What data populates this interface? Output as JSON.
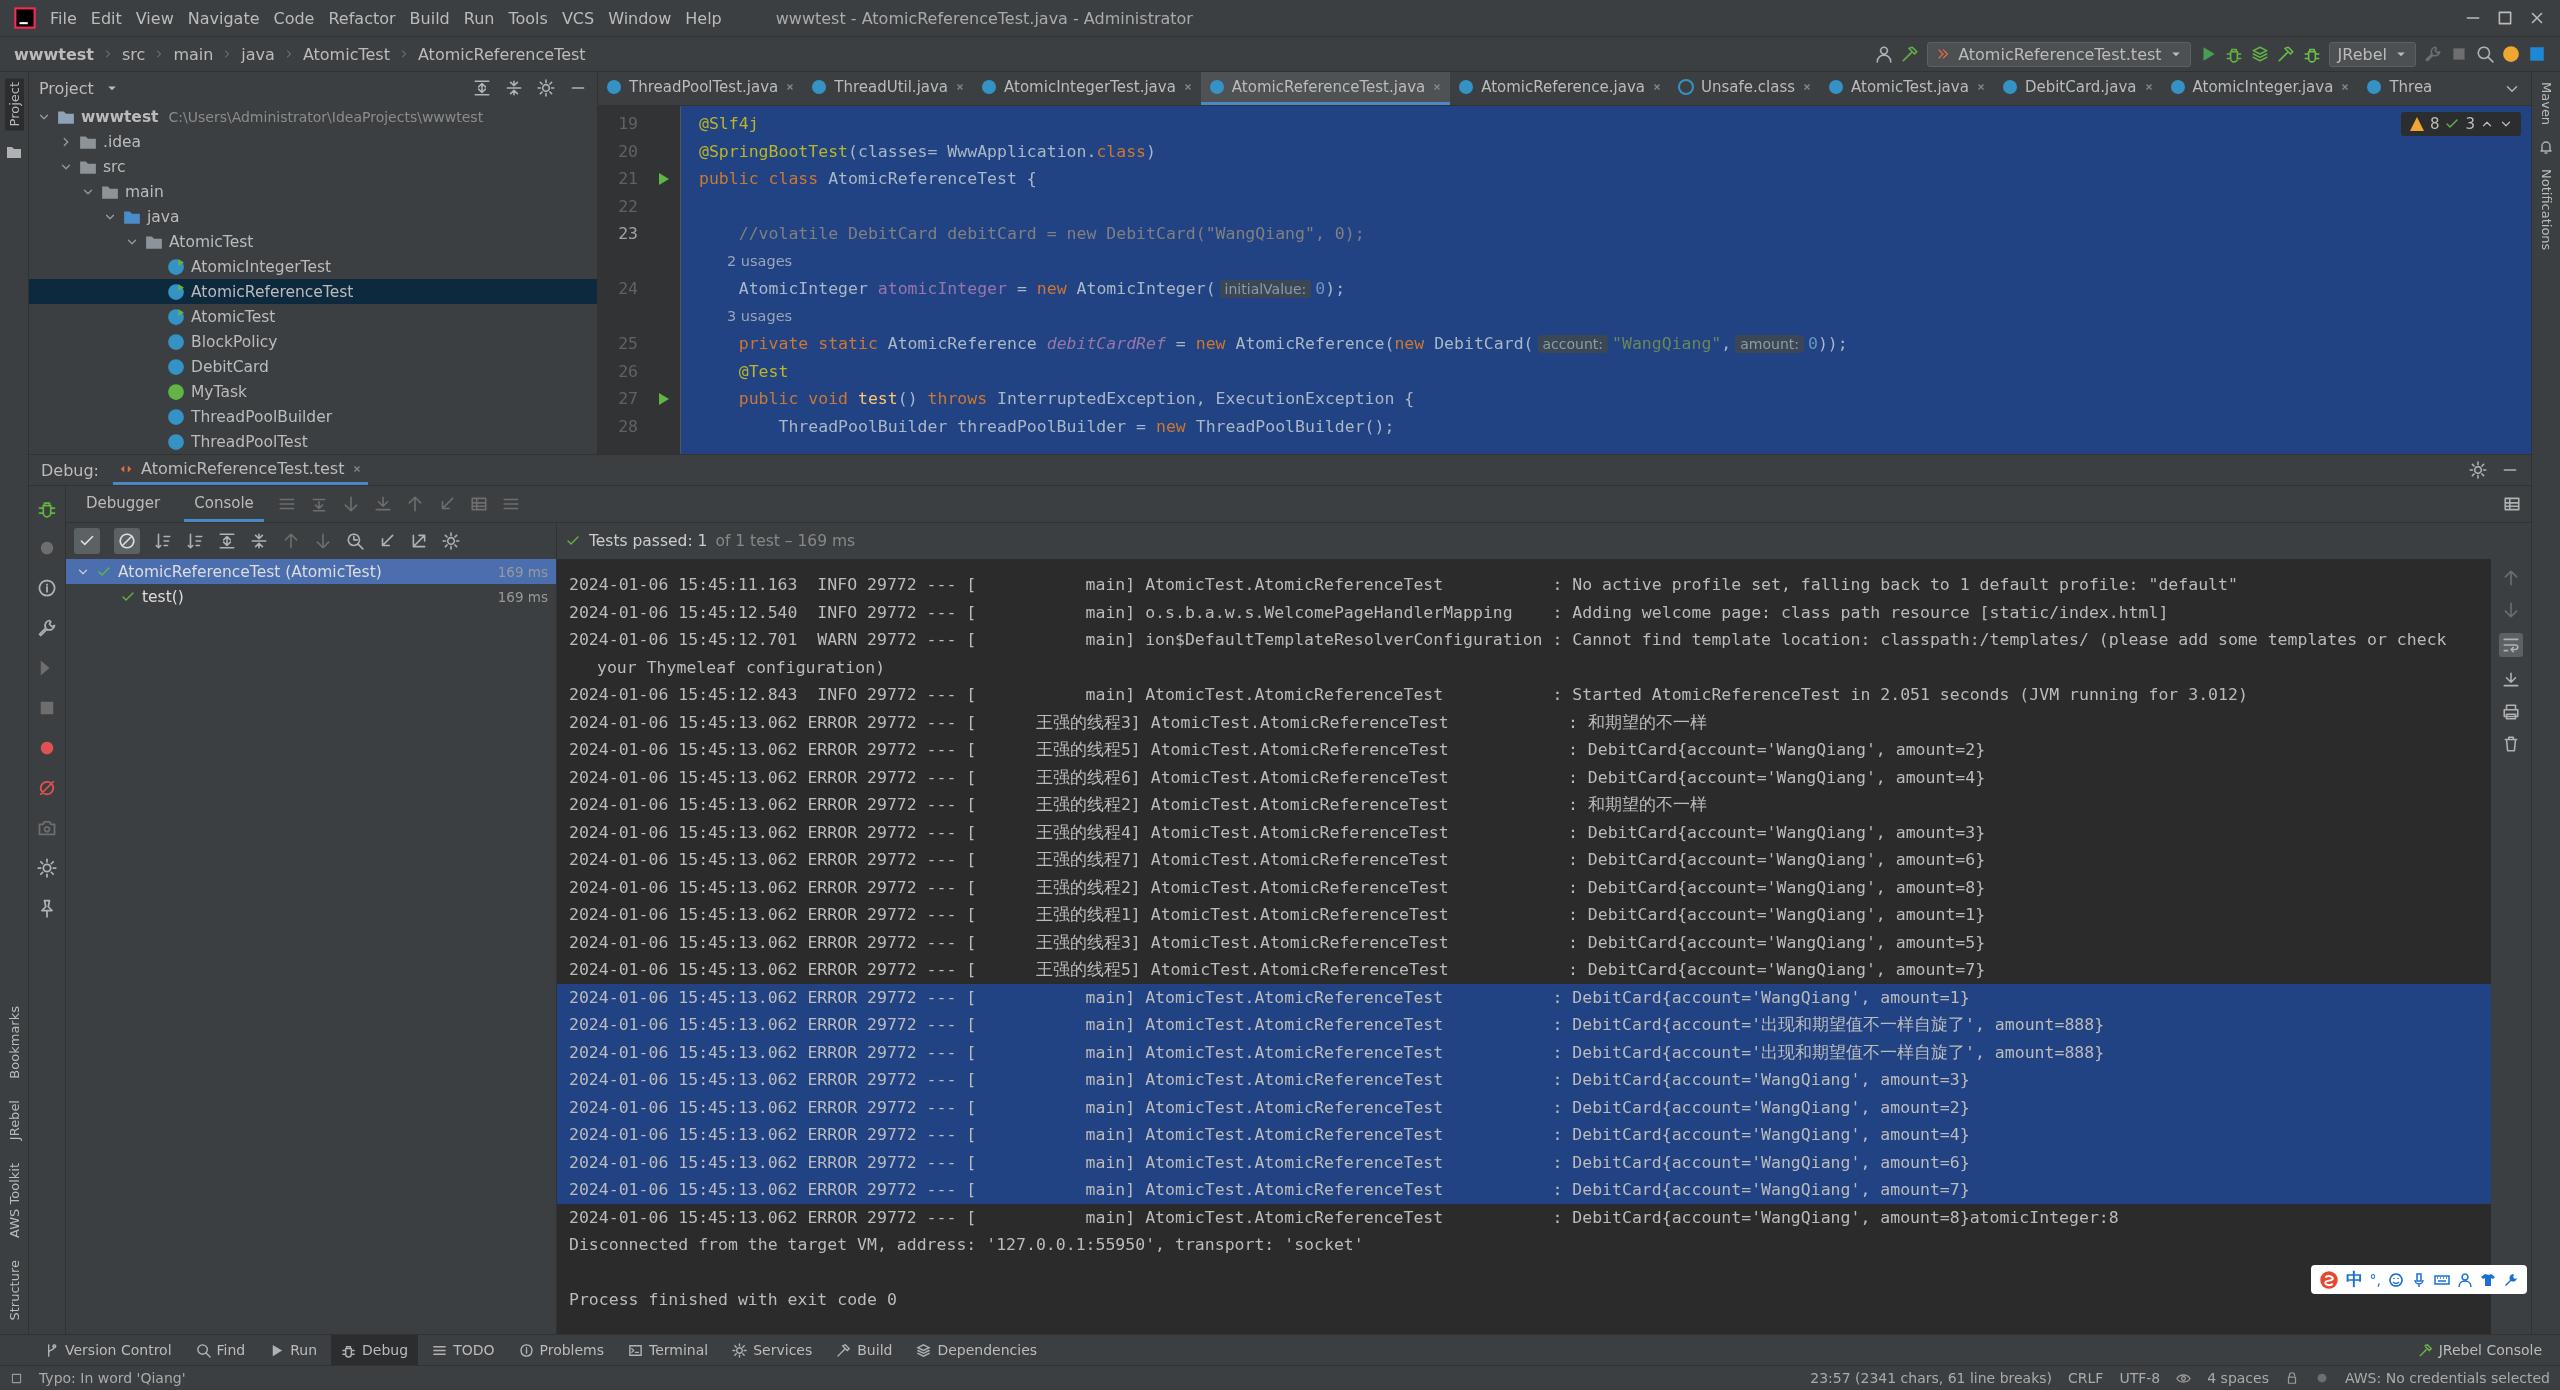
{
  "window": {
    "title": "wwwtest - AtomicReferenceTest.java - Administrator"
  },
  "menu": [
    "File",
    "Edit",
    "View",
    "Navigate",
    "Code",
    "Refactor",
    "Build",
    "Run",
    "Tools",
    "VCS",
    "Window",
    "Help"
  ],
  "breadcrumbs": [
    "wwwtest",
    "src",
    "main",
    "java",
    "AtomicTest",
    "AtomicReferenceTest"
  ],
  "run_config": {
    "label": "AtomicReferenceTest.test"
  },
  "jrebel": {
    "label": "JRebel"
  },
  "project_panel": {
    "title": "Project",
    "tree": [
      {
        "label": "wwwtest",
        "path": "C:\\Users\\Administrator\\IdeaProjects\\wwwtest",
        "kind": "module",
        "expanded": true,
        "selected": false,
        "children": [
          {
            "label": ".idea",
            "kind": "folder",
            "expanded": false,
            "selected": false
          },
          {
            "label": "src",
            "kind": "folder",
            "expanded": true,
            "selected": false,
            "children": [
              {
                "label": "main",
                "kind": "folder",
                "expanded": true,
                "selected": false,
                "children": [
                  {
                    "label": "java",
                    "kind": "source",
                    "expanded": true,
                    "selected": false,
                    "children": [
                      {
                        "label": "AtomicTest",
                        "kind": "package",
                        "expanded": true,
                        "selected": false,
                        "children": [
                          {
                            "label": "AtomicIntegerTest",
                            "kind": "test-class",
                            "selected": false
                          },
                          {
                            "label": "AtomicReferenceTest",
                            "kind": "test-class",
                            "selected": true
                          },
                          {
                            "label": "AtomicTest",
                            "kind": "test-class",
                            "selected": false
                          },
                          {
                            "label": "BlockPolicy",
                            "kind": "class",
                            "selected": false
                          },
                          {
                            "label": "DebitCard",
                            "kind": "class",
                            "selected": false
                          },
                          {
                            "label": "MyTask",
                            "kind": "interface",
                            "selected": false
                          },
                          {
                            "label": "ThreadPoolBuilder",
                            "kind": "class",
                            "selected": false
                          },
                          {
                            "label": "ThreadPoolTest",
                            "kind": "class",
                            "selected": false
                          }
                        ]
                      }
                    ]
                  }
                ]
              }
            ]
          }
        ]
      }
    ]
  },
  "editor_tabs": [
    {
      "label": "ThreadPoolTest.java",
      "kind": "class",
      "selected": false
    },
    {
      "label": "ThreadUtil.java",
      "kind": "class",
      "selected": false
    },
    {
      "label": "AtomicIntegerTest.java",
      "kind": "class",
      "selected": false
    },
    {
      "label": "AtomicReferenceTest.java",
      "kind": "class",
      "selected": true
    },
    {
      "label": "AtomicReference.java",
      "kind": "class",
      "selected": false
    },
    {
      "label": "Unsafe.class",
      "kind": "compiled",
      "selected": false
    },
    {
      "label": "AtomicTest.java",
      "kind": "class",
      "selected": false
    },
    {
      "label": "DebitCard.java",
      "kind": "class",
      "selected": false
    },
    {
      "label": "AtomicInteger.java",
      "kind": "class",
      "selected": false
    },
    {
      "label": "Threa",
      "kind": "class",
      "selected": false
    }
  ],
  "inspections": {
    "warnings": "8",
    "typos": "3"
  },
  "code_lines": [
    {
      "kind": "code",
      "number": "19",
      "tokens": [
        {
          "kind": "ann",
          "text": "@Slf4j"
        }
      ]
    },
    {
      "kind": "code",
      "number": "20",
      "tokens": [
        {
          "kind": "ann",
          "text": "@SpringBootTest"
        },
        {
          "kind": "plain",
          "text": "(classes= WwwApplication."
        },
        {
          "kind": "kw",
          "text": "class"
        },
        {
          "kind": "plain",
          "text": ")"
        }
      ]
    },
    {
      "kind": "code",
      "number": "21",
      "run": true,
      "tokens": [
        {
          "kind": "kw",
          "text": "public class "
        },
        {
          "kind": "plain",
          "text": "AtomicReferenceTest {"
        }
      ]
    },
    {
      "kind": "code",
      "number": "22"
    },
    {
      "kind": "code",
      "number": "23",
      "current": true,
      "tokens": [
        {
          "kind": "comment",
          "text": "    //volatile DebitCard debitCard = new DebitCard(\"WangQiang\", 0);"
        }
      ]
    },
    {
      "kind": "usages",
      "text": "2 usages"
    },
    {
      "kind": "code",
      "number": "24",
      "tokens": [
        {
          "kind": "plain",
          "text": "    AtomicInteger "
        },
        {
          "kind": "field",
          "text": "atomicInteger"
        },
        {
          "kind": "plain",
          "text": " = "
        },
        {
          "kind": "kw",
          "text": "new "
        },
        {
          "kind": "plain",
          "text": "AtomicInteger("
        },
        {
          "kind": "hint",
          "text": "initialValue:"
        },
        {
          "kind": "num",
          "text": "0"
        },
        {
          "kind": "plain",
          "text": ");"
        }
      ]
    },
    {
      "kind": "usages",
      "text": "3 usages"
    },
    {
      "kind": "code",
      "number": "25",
      "tokens": [
        {
          "kind": "kw",
          "text": "    private static "
        },
        {
          "kind": "plain",
          "text": "AtomicReference "
        },
        {
          "kind": "static",
          "text": "debitCardRef"
        },
        {
          "kind": "plain",
          "text": " = "
        },
        {
          "kind": "kw",
          "text": "new "
        },
        {
          "kind": "plain",
          "text": "AtomicReference("
        },
        {
          "kind": "kw",
          "text": "new "
        },
        {
          "kind": "plain",
          "text": "DebitCard("
        },
        {
          "kind": "hint",
          "text": "account:"
        },
        {
          "kind": "str",
          "text": "\"WangQiang\""
        },
        {
          "kind": "plain",
          "text": ","
        },
        {
          "kind": "hint",
          "text": "amount:"
        },
        {
          "kind": "num",
          "text": "0"
        },
        {
          "kind": "plain",
          "text": "));"
        }
      ]
    },
    {
      "kind": "code",
      "number": "26",
      "tokens": [
        {
          "kind": "ann",
          "text": "    @Test"
        }
      ]
    },
    {
      "kind": "code",
      "number": "27",
      "run": true,
      "tokens": [
        {
          "kind": "kw",
          "text": "    public void "
        },
        {
          "kind": "fn",
          "text": "test"
        },
        {
          "kind": "plain",
          "text": "() "
        },
        {
          "kind": "kw",
          "text": "throws "
        },
        {
          "kind": "plain",
          "text": "InterruptedException, ExecutionException {"
        }
      ]
    },
    {
      "kind": "code",
      "number": "28",
      "tokens": [
        {
          "kind": "plain",
          "text": "        ThreadPoolBuilder threadPoolBuilder = "
        },
        {
          "kind": "kw",
          "text": "new "
        },
        {
          "kind": "plain",
          "text": "ThreadPoolBuilder();"
        }
      ]
    }
  ],
  "debug": {
    "label": "Debug:",
    "session_tab": "AtomicReferenceTest.test",
    "tabs": [
      {
        "label": "Debugger",
        "selected": false
      },
      {
        "label": "Console",
        "selected": true
      }
    ],
    "tests_passed": "Tests passed: 1",
    "tests_summary": "of 1 test – 169 ms",
    "test_tree": [
      {
        "label": "AtomicReferenceTest (AtomicTest)",
        "time": "169 ms",
        "expanded": true,
        "selected": true,
        "children": [
          {
            "label": "test()",
            "time": "169 ms",
            "selected": false
          }
        ]
      }
    ]
  },
  "console_lines": [
    {
      "kind": "log",
      "selected": false,
      "text": "2024-01-06 15:45:11.163  INFO 29772 --- [           main] AtomicTest.AtomicReferenceTest           : No active profile set, falling back to 1 default profile: \"default\""
    },
    {
      "kind": "log",
      "selected": false,
      "text": "2024-01-06 15:45:12.540  INFO 29772 --- [           main] o.s.b.a.w.s.WelcomePageHandlerMapping    : Adding welcome page: class path resource [static/index.html]"
    },
    {
      "kind": "log",
      "selected": false,
      "text": "2024-01-06 15:45:12.701  WARN 29772 --- [           main] ion$DefaultTemplateResolverConfiguration : Cannot find template location: classpath:/templates/ (please add some templates or check"
    },
    {
      "kind": "wrap",
      "selected": false,
      "text": "your Thymeleaf configuration)"
    },
    {
      "kind": "log",
      "selected": false,
      "text": "2024-01-06 15:45:12.843  INFO 29772 --- [           main] AtomicTest.AtomicReferenceTest           : Started AtomicReferenceTest in 2.051 seconds (JVM running for 3.012)"
    },
    {
      "kind": "log",
      "selected": false,
      "text": "2024-01-06 15:45:13.062 ERROR 29772 --- [      王强的线程3] AtomicTest.AtomicReferenceTest            : 和期望的不一样"
    },
    {
      "kind": "log",
      "selected": false,
      "text": "2024-01-06 15:45:13.062 ERROR 29772 --- [      王强的线程5] AtomicTest.AtomicReferenceTest            : DebitCard{account='WangQiang', amount=2}"
    },
    {
      "kind": "log",
      "selected": false,
      "text": "2024-01-06 15:45:13.062 ERROR 29772 --- [      王强的线程6] AtomicTest.AtomicReferenceTest            : DebitCard{account='WangQiang', amount=4}"
    },
    {
      "kind": "log",
      "selected": false,
      "text": "2024-01-06 15:45:13.062 ERROR 29772 --- [      王强的线程2] AtomicTest.AtomicReferenceTest            : 和期望的不一样"
    },
    {
      "kind": "log",
      "selected": false,
      "text": "2024-01-06 15:45:13.062 ERROR 29772 --- [      王强的线程4] AtomicTest.AtomicReferenceTest            : DebitCard{account='WangQiang', amount=3}"
    },
    {
      "kind": "log",
      "selected": false,
      "text": "2024-01-06 15:45:13.062 ERROR 29772 --- [      王强的线程7] AtomicTest.AtomicReferenceTest            : DebitCard{account='WangQiang', amount=6}"
    },
    {
      "kind": "log",
      "selected": false,
      "text": "2024-01-06 15:45:13.062 ERROR 29772 --- [      王强的线程2] AtomicTest.AtomicReferenceTest            : DebitCard{account='WangQiang', amount=8}"
    },
    {
      "kind": "log",
      "selected": false,
      "text": "2024-01-06 15:45:13.062 ERROR 29772 --- [      王强的线程1] AtomicTest.AtomicReferenceTest            : DebitCard{account='WangQiang', amount=1}"
    },
    {
      "kind": "log",
      "selected": false,
      "text": "2024-01-06 15:45:13.062 ERROR 29772 --- [      王强的线程3] AtomicTest.AtomicReferenceTest            : DebitCard{account='WangQiang', amount=5}"
    },
    {
      "kind": "log",
      "selected": false,
      "text": "2024-01-06 15:45:13.062 ERROR 29772 --- [      王强的线程5] AtomicTest.AtomicReferenceTest            : DebitCard{account='WangQiang', amount=7}"
    },
    {
      "kind": "log",
      "selected": true,
      "text": "2024-01-06 15:45:13.062 ERROR 29772 --- [           main] AtomicTest.AtomicReferenceTest           : DebitCard{account='WangQiang', amount=1}"
    },
    {
      "kind": "log",
      "selected": true,
      "text": "2024-01-06 15:45:13.062 ERROR 29772 --- [           main] AtomicTest.AtomicReferenceTest           : DebitCard{account='出现和期望值不一样自旋了', amount=888}"
    },
    {
      "kind": "log",
      "selected": true,
      "text": "2024-01-06 15:45:13.062 ERROR 29772 --- [           main] AtomicTest.AtomicReferenceTest           : DebitCard{account='出现和期望值不一样自旋了', amount=888}"
    },
    {
      "kind": "log",
      "selected": true,
      "text": "2024-01-06 15:45:13.062 ERROR 29772 --- [           main] AtomicTest.AtomicReferenceTest           : DebitCard{account='WangQiang', amount=3}"
    },
    {
      "kind": "log",
      "selected": true,
      "text": "2024-01-06 15:45:13.062 ERROR 29772 --- [           main] AtomicTest.AtomicReferenceTest           : DebitCard{account='WangQiang', amount=2}"
    },
    {
      "kind": "log",
      "selected": true,
      "text": "2024-01-06 15:45:13.062 ERROR 29772 --- [           main] AtomicTest.AtomicReferenceTest           : DebitCard{account='WangQiang', amount=4}"
    },
    {
      "kind": "log",
      "selected": true,
      "text": "2024-01-06 15:45:13.062 ERROR 29772 --- [           main] AtomicTest.AtomicReferenceTest           : DebitCard{account='WangQiang', amount=6}"
    },
    {
      "kind": "log",
      "selected": true,
      "text": "2024-01-06 15:45:13.062 ERROR 29772 --- [           main] AtomicTest.AtomicReferenceTest           : DebitCard{account='WangQiang', amount=7}"
    },
    {
      "kind": "log",
      "selected": false,
      "text": "2024-01-06 15:45:13.062 ERROR 29772 --- [           main] AtomicTest.AtomicReferenceTest           : DebitCard{account='WangQiang', amount=8}atomicInteger:8"
    },
    {
      "kind": "log",
      "selected": false,
      "text": "Disconnected from the target VM, address: '127.0.0.1:55950', transport: 'socket'"
    },
    {
      "kind": "exit",
      "selected": false,
      "text": "Process finished with exit code 0"
    }
  ],
  "ime_toolbar": {
    "mode": "中",
    "punctuation": "°,"
  },
  "left_stripe": {
    "top": [
      {
        "label": "Project",
        "selected": true
      }
    ],
    "bottom": [
      {
        "label": "Bookmarks",
        "selected": false
      },
      {
        "label": "JRebel",
        "selected": false
      },
      {
        "label": "AWS Toolkit",
        "selected": false
      },
      {
        "label": "Structure",
        "selected": false
      }
    ]
  },
  "right_stripe": [
    "Maven",
    "Notifications"
  ],
  "tool_windows": [
    {
      "label": "Version Control",
      "selected": false
    },
    {
      "label": "Find",
      "selected": false
    },
    {
      "label": "Run",
      "selected": false
    },
    {
      "label": "Debug",
      "selected": true
    },
    {
      "label": "TODO",
      "selected": false
    },
    {
      "label": "Problems",
      "selected": false
    },
    {
      "label": "Terminal",
      "selected": false
    },
    {
      "label": "Services",
      "selected": false
    },
    {
      "label": "Build",
      "selected": false
    },
    {
      "label": "Dependencies",
      "selected": false
    }
  ],
  "jrebel_console": "JRebel Console",
  "status_bar": {
    "message": "Typo: In word 'Qiang'",
    "position": "23:57 (2341 chars, 61 line breaks)",
    "line_separator": "CRLF",
    "encoding": "UTF-8",
    "indent": "4 spaces",
    "aws": "AWS: No credentials selected"
  }
}
